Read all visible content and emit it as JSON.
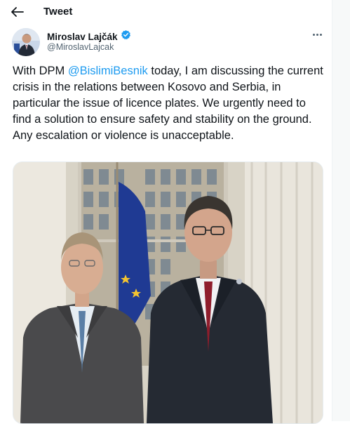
{
  "header": {
    "back_icon": "back-arrow-icon",
    "title": "Tweet"
  },
  "tweet": {
    "author": {
      "name": "Miroslav Lajčák",
      "handle": "@MiroslavLajcak",
      "verified_icon": "verified-badge-icon",
      "verified_color": "#1d9bf0"
    },
    "more_icon": "more-options-icon",
    "text": {
      "before": "With DPM ",
      "mention": "@BislimiBesnik",
      "after": " today, I am discussing the current crisis in the relations between Kosovo and Serbia, in particular the issue of licence plates. We urgently need to find a solution to ensure safety and stability on the ground. Any escalation or violence is unacceptable."
    },
    "photo_icon": "tweet-photo",
    "accent_color": "#1d9bf0"
  }
}
